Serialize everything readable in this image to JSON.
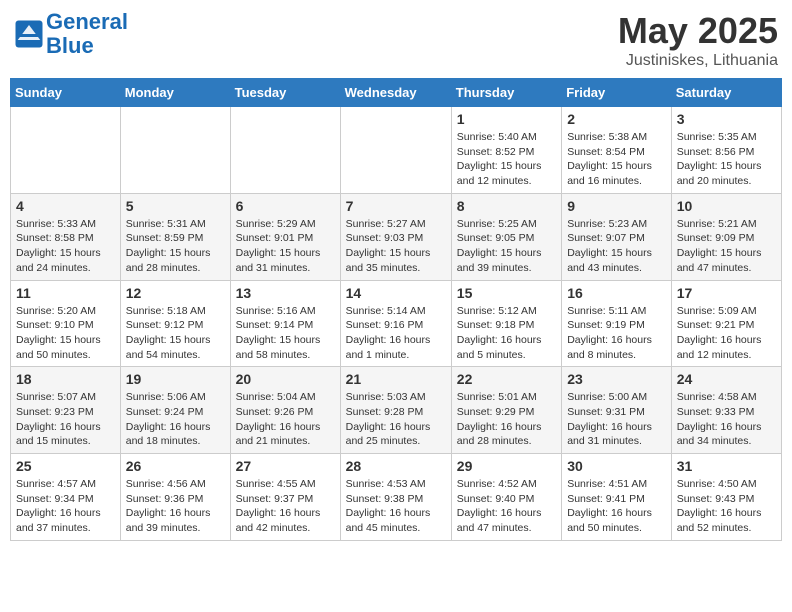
{
  "header": {
    "logo_line1": "General",
    "logo_line2": "Blue",
    "month": "May 2025",
    "location": "Justiniskes, Lithuania"
  },
  "weekdays": [
    "Sunday",
    "Monday",
    "Tuesday",
    "Wednesday",
    "Thursday",
    "Friday",
    "Saturday"
  ],
  "weeks": [
    [
      {
        "day": "",
        "info": ""
      },
      {
        "day": "",
        "info": ""
      },
      {
        "day": "",
        "info": ""
      },
      {
        "day": "",
        "info": ""
      },
      {
        "day": "1",
        "info": "Sunrise: 5:40 AM\nSunset: 8:52 PM\nDaylight: 15 hours\nand 12 minutes."
      },
      {
        "day": "2",
        "info": "Sunrise: 5:38 AM\nSunset: 8:54 PM\nDaylight: 15 hours\nand 16 minutes."
      },
      {
        "day": "3",
        "info": "Sunrise: 5:35 AM\nSunset: 8:56 PM\nDaylight: 15 hours\nand 20 minutes."
      }
    ],
    [
      {
        "day": "4",
        "info": "Sunrise: 5:33 AM\nSunset: 8:58 PM\nDaylight: 15 hours\nand 24 minutes."
      },
      {
        "day": "5",
        "info": "Sunrise: 5:31 AM\nSunset: 8:59 PM\nDaylight: 15 hours\nand 28 minutes."
      },
      {
        "day": "6",
        "info": "Sunrise: 5:29 AM\nSunset: 9:01 PM\nDaylight: 15 hours\nand 31 minutes."
      },
      {
        "day": "7",
        "info": "Sunrise: 5:27 AM\nSunset: 9:03 PM\nDaylight: 15 hours\nand 35 minutes."
      },
      {
        "day": "8",
        "info": "Sunrise: 5:25 AM\nSunset: 9:05 PM\nDaylight: 15 hours\nand 39 minutes."
      },
      {
        "day": "9",
        "info": "Sunrise: 5:23 AM\nSunset: 9:07 PM\nDaylight: 15 hours\nand 43 minutes."
      },
      {
        "day": "10",
        "info": "Sunrise: 5:21 AM\nSunset: 9:09 PM\nDaylight: 15 hours\nand 47 minutes."
      }
    ],
    [
      {
        "day": "11",
        "info": "Sunrise: 5:20 AM\nSunset: 9:10 PM\nDaylight: 15 hours\nand 50 minutes."
      },
      {
        "day": "12",
        "info": "Sunrise: 5:18 AM\nSunset: 9:12 PM\nDaylight: 15 hours\nand 54 minutes."
      },
      {
        "day": "13",
        "info": "Sunrise: 5:16 AM\nSunset: 9:14 PM\nDaylight: 15 hours\nand 58 minutes."
      },
      {
        "day": "14",
        "info": "Sunrise: 5:14 AM\nSunset: 9:16 PM\nDaylight: 16 hours\nand 1 minute."
      },
      {
        "day": "15",
        "info": "Sunrise: 5:12 AM\nSunset: 9:18 PM\nDaylight: 16 hours\nand 5 minutes."
      },
      {
        "day": "16",
        "info": "Sunrise: 5:11 AM\nSunset: 9:19 PM\nDaylight: 16 hours\nand 8 minutes."
      },
      {
        "day": "17",
        "info": "Sunrise: 5:09 AM\nSunset: 9:21 PM\nDaylight: 16 hours\nand 12 minutes."
      }
    ],
    [
      {
        "day": "18",
        "info": "Sunrise: 5:07 AM\nSunset: 9:23 PM\nDaylight: 16 hours\nand 15 minutes."
      },
      {
        "day": "19",
        "info": "Sunrise: 5:06 AM\nSunset: 9:24 PM\nDaylight: 16 hours\nand 18 minutes."
      },
      {
        "day": "20",
        "info": "Sunrise: 5:04 AM\nSunset: 9:26 PM\nDaylight: 16 hours\nand 21 minutes."
      },
      {
        "day": "21",
        "info": "Sunrise: 5:03 AM\nSunset: 9:28 PM\nDaylight: 16 hours\nand 25 minutes."
      },
      {
        "day": "22",
        "info": "Sunrise: 5:01 AM\nSunset: 9:29 PM\nDaylight: 16 hours\nand 28 minutes."
      },
      {
        "day": "23",
        "info": "Sunrise: 5:00 AM\nSunset: 9:31 PM\nDaylight: 16 hours\nand 31 minutes."
      },
      {
        "day": "24",
        "info": "Sunrise: 4:58 AM\nSunset: 9:33 PM\nDaylight: 16 hours\nand 34 minutes."
      }
    ],
    [
      {
        "day": "25",
        "info": "Sunrise: 4:57 AM\nSunset: 9:34 PM\nDaylight: 16 hours\nand 37 minutes."
      },
      {
        "day": "26",
        "info": "Sunrise: 4:56 AM\nSunset: 9:36 PM\nDaylight: 16 hours\nand 39 minutes."
      },
      {
        "day": "27",
        "info": "Sunrise: 4:55 AM\nSunset: 9:37 PM\nDaylight: 16 hours\nand 42 minutes."
      },
      {
        "day": "28",
        "info": "Sunrise: 4:53 AM\nSunset: 9:38 PM\nDaylight: 16 hours\nand 45 minutes."
      },
      {
        "day": "29",
        "info": "Sunrise: 4:52 AM\nSunset: 9:40 PM\nDaylight: 16 hours\nand 47 minutes."
      },
      {
        "day": "30",
        "info": "Sunrise: 4:51 AM\nSunset: 9:41 PM\nDaylight: 16 hours\nand 50 minutes."
      },
      {
        "day": "31",
        "info": "Sunrise: 4:50 AM\nSunset: 9:43 PM\nDaylight: 16 hours\nand 52 minutes."
      }
    ]
  ]
}
